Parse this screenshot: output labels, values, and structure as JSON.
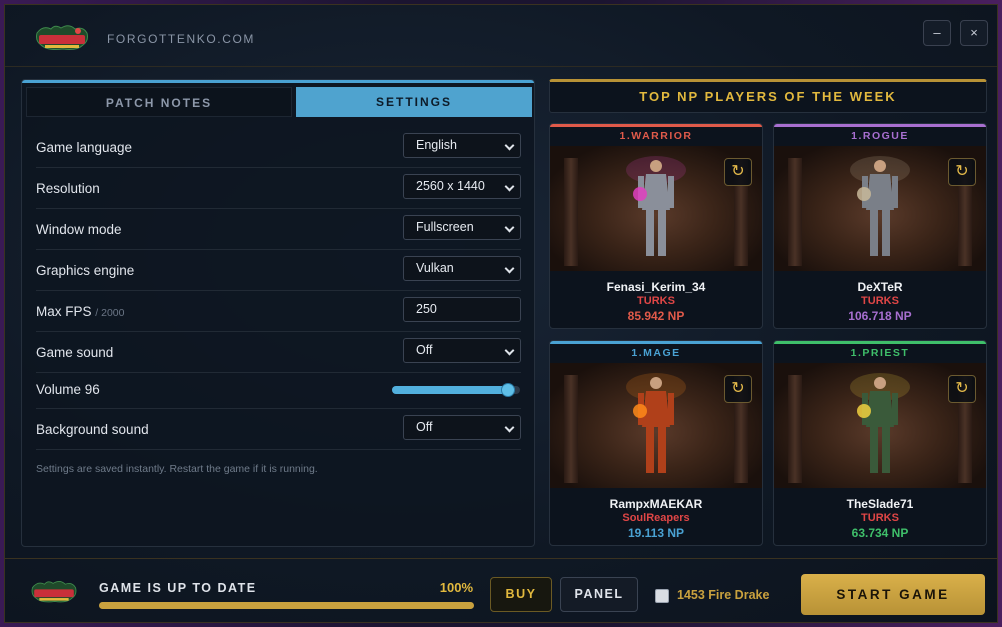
{
  "window": {
    "site_name": "FORGOTTENKO.COM",
    "logo_text": "Forgottenko",
    "minimize_label": "–",
    "close_label": "×"
  },
  "tabs": {
    "patch_notes": "PATCH NOTES",
    "settings": "SETTINGS",
    "active": "settings"
  },
  "settings": {
    "game_language": {
      "label": "Game language",
      "value": "English"
    },
    "resolution": {
      "label": "Resolution",
      "value": "2560 x 1440"
    },
    "window_mode": {
      "label": "Window mode",
      "value": "Fullscreen"
    },
    "graphics_engine": {
      "label": "Graphics engine",
      "value": "Vulkan"
    },
    "max_fps": {
      "label": "Max FPS",
      "sub": "/ 2000",
      "value": "250"
    },
    "game_sound": {
      "label": "Game sound",
      "value": "Off"
    },
    "volume": {
      "label": "Volume 96",
      "level": 96
    },
    "background_sound": {
      "label": "Background sound",
      "value": "Off"
    },
    "note": "Settings are saved instantly. Restart the game if it is running."
  },
  "top_players": {
    "title": "TOP NP PLAYERS OF THE WEEK",
    "cards": [
      {
        "rank": "1.WARRIOR",
        "name": "Fenasi_Kerim_34",
        "guild": "TURKS",
        "np": "85.942 NP",
        "color": "#e05a4a",
        "np_color": "#e05a4a",
        "guild_color": "#e04646"
      },
      {
        "rank": "1.ROGUE",
        "name": "DeXTeR",
        "guild": "TURKS",
        "np": "106.718 NP",
        "color": "#a86fd0",
        "np_color": "#a86fd0",
        "guild_color": "#e04646"
      },
      {
        "rank": "1.MAGE",
        "name": "RampxMAEKAR",
        "guild": "SoulReapers",
        "np": "19.113 NP",
        "color": "#4aa2d3",
        "np_color": "#4aa2d3",
        "guild_color": "#e04646"
      },
      {
        "rank": "1.PRIEST",
        "name": "TheSlade71",
        "guild": "TURKS",
        "np": "63.734 NP",
        "color": "#3fbf6a",
        "np_color": "#3fbf6a",
        "guild_color": "#e04646"
      }
    ]
  },
  "bottom": {
    "status": "GAME IS UP TO DATE",
    "percent": "100%",
    "progress": 1.0,
    "buy": "BUY",
    "panel": "PANEL",
    "checkbox_label": "1453 Fire Drake",
    "start": "START GAME"
  },
  "colors": {
    "accent_gold": "#e2b93e",
    "accent_blue": "#4fa3cf"
  }
}
